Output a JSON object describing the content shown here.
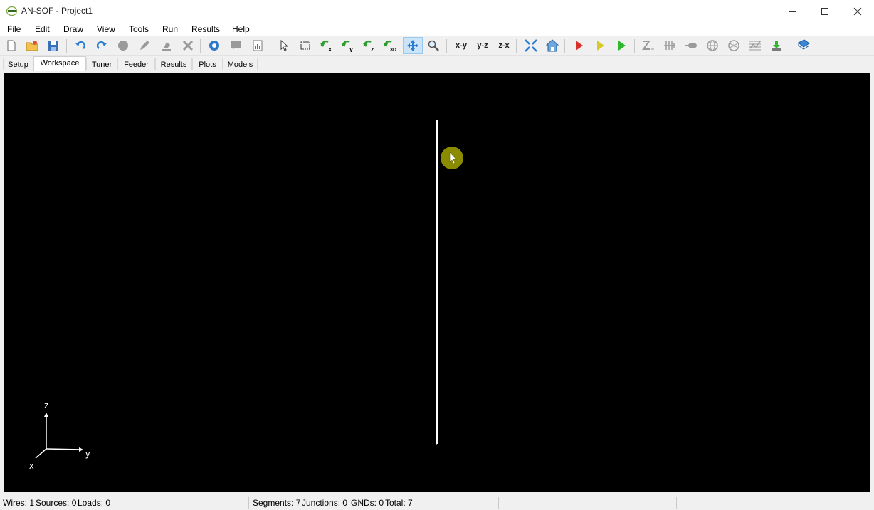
{
  "window": {
    "title": "AN-SOF - Project1",
    "icons": {
      "minimize": "minimize-icon",
      "maximize": "maximize-icon",
      "close": "close-icon"
    }
  },
  "menu": [
    "File",
    "Edit",
    "Draw",
    "View",
    "Tools",
    "Run",
    "Results",
    "Help"
  ],
  "toolbar": {
    "plane_xy": "x-y",
    "plane_yz": "y-z",
    "plane_zx": "z-x",
    "active_tool": "pan"
  },
  "tabs": [
    "Setup",
    "Workspace",
    "Tuner",
    "Feeder",
    "Results",
    "Plots",
    "Models"
  ],
  "active_tab": "Workspace",
  "workspace": {
    "axes": {
      "z": "z",
      "y": "y",
      "x": "x"
    },
    "colors": {
      "background": "#000000",
      "wire": "#ffffff",
      "cursor_highlight": "#8b8b00"
    }
  },
  "status": {
    "wires": "Wires: 1",
    "sources": "Sources: 0",
    "loads": "Loads: 0",
    "segments": "Segments: 7",
    "junctions": "Junctions: 0",
    "gnds": "GNDs: 0",
    "total": "Total: 7"
  }
}
